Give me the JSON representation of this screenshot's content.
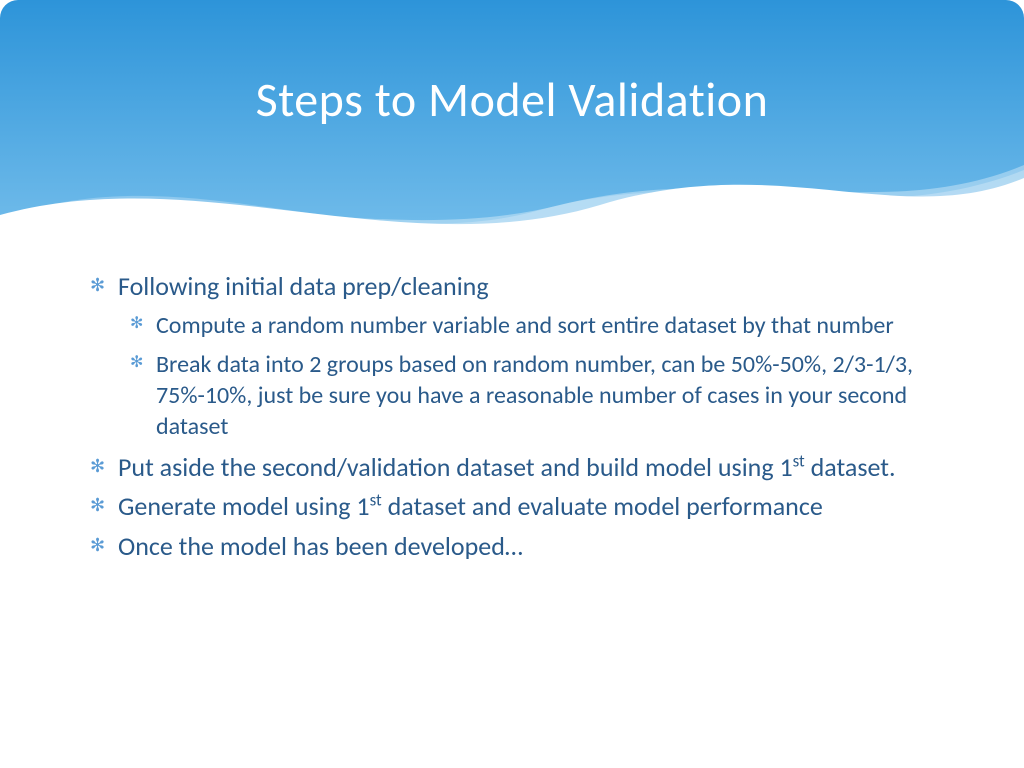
{
  "title": "Steps to Model Validation",
  "bullets": {
    "b1": "Following initial data prep/cleaning",
    "b1a": "Compute a random number variable and sort entire dataset by that number",
    "b1b": "Break data into 2 groups based on random number, can be 50%-50%, 2/3-1/3, 75%-10%, just be sure you have a reasonable number of cases in your second dataset",
    "b2_pre": "Put aside the second/validation dataset and build model using 1",
    "b2_sup": "st",
    "b2_post": " dataset.",
    "b3_pre": "Generate model using 1",
    "b3_sup": "st",
    "b3_post": " dataset and evaluate model performance",
    "b4": "Once the model has been developed…"
  }
}
